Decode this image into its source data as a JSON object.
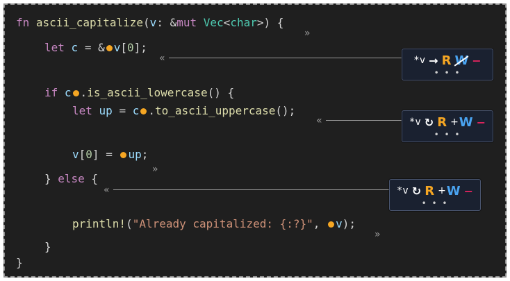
{
  "code": {
    "lines": [
      {
        "id": "l1",
        "tokens": [
          {
            "t": "fn",
            "c": "kw"
          },
          {
            "t": " ",
            "c": "punc"
          },
          {
            "t": "ascii_capitalize",
            "c": "fn"
          },
          {
            "t": "(",
            "c": "punc"
          },
          {
            "t": "v",
            "c": "var"
          },
          {
            "t": ": &",
            "c": "punc"
          },
          {
            "t": "mut",
            "c": "kw"
          },
          {
            "t": " ",
            "c": "punc"
          },
          {
            "t": "Vec",
            "c": "ty"
          },
          {
            "t": "<",
            "c": "punc"
          },
          {
            "t": "char",
            "c": "ty"
          },
          {
            "t": ">) {",
            "c": "punc"
          }
        ]
      },
      {
        "id": "l2",
        "tokens": [
          {
            "t": "let",
            "c": "kw"
          },
          {
            "t": " ",
            "c": "punc"
          },
          {
            "t": "c",
            "c": "var"
          },
          {
            "t": " = &",
            "c": "punc"
          },
          {
            "t": "DOT",
            "c": "dot"
          },
          {
            "t": "v",
            "c": "var"
          },
          {
            "t": "[",
            "c": "punc"
          },
          {
            "t": "0",
            "c": "num"
          },
          {
            "t": "];",
            "c": "punc"
          }
        ]
      },
      {
        "id": "l3",
        "tokens": [
          {
            "t": "if",
            "c": "kw"
          },
          {
            "t": " ",
            "c": "punc"
          },
          {
            "t": "c",
            "c": "var"
          },
          {
            "t": "DOT",
            "c": "dot"
          },
          {
            "t": ".",
            "c": "punc"
          },
          {
            "t": "is_ascii_lowercase",
            "c": "fn"
          },
          {
            "t": "() {",
            "c": "punc"
          }
        ]
      },
      {
        "id": "l4",
        "tokens": [
          {
            "t": "let",
            "c": "kw"
          },
          {
            "t": " ",
            "c": "punc"
          },
          {
            "t": "up",
            "c": "var"
          },
          {
            "t": " = ",
            "c": "punc"
          },
          {
            "t": "c",
            "c": "var"
          },
          {
            "t": "DOT",
            "c": "dot"
          },
          {
            "t": ".",
            "c": "punc"
          },
          {
            "t": "to_ascii_uppercase",
            "c": "fn"
          },
          {
            "t": "();",
            "c": "punc"
          }
        ]
      },
      {
        "id": "l5",
        "tokens": [
          {
            "t": "v",
            "c": "var"
          },
          {
            "t": "[",
            "c": "punc"
          },
          {
            "t": "0",
            "c": "num"
          },
          {
            "t": "] = ",
            "c": "punc"
          },
          {
            "t": "DOT",
            "c": "dot"
          },
          {
            "t": "up",
            "c": "var"
          },
          {
            "t": ";",
            "c": "punc"
          }
        ]
      },
      {
        "id": "l6",
        "tokens": [
          {
            "t": "} ",
            "c": "punc"
          },
          {
            "t": "else",
            "c": "kw"
          },
          {
            "t": " {",
            "c": "punc"
          }
        ]
      },
      {
        "id": "l7",
        "tokens": [
          {
            "t": "println!",
            "c": "fn"
          },
          {
            "t": "(",
            "c": "punc"
          },
          {
            "t": "\"Already capitalized: {:?}\"",
            "c": "str"
          },
          {
            "t": ", ",
            "c": "punc"
          },
          {
            "t": "DOT",
            "c": "dot"
          },
          {
            "t": "v",
            "c": "var"
          },
          {
            "t": ");",
            "c": "punc"
          }
        ]
      },
      {
        "id": "l8",
        "tokens": [
          {
            "t": "}",
            "c": "punc"
          }
        ]
      },
      {
        "id": "l9",
        "tokens": [
          {
            "t": "}",
            "c": "punc"
          }
        ]
      }
    ]
  },
  "markers": {
    "open": "«",
    "close": "»"
  },
  "permission_boxes": [
    {
      "place": "*v",
      "icon": "→",
      "icon_name": "arrow-right-icon",
      "r": "R",
      "w": "W",
      "w_crossed": true,
      "plus": "",
      "minus": "−",
      "more": "• • •"
    },
    {
      "place": "*v",
      "icon": "↻",
      "icon_name": "restore-icon",
      "r": "R",
      "w": "W",
      "w_crossed": false,
      "plus": "+",
      "minus": "−",
      "more": "• • •"
    },
    {
      "place": "*v",
      "icon": "↻",
      "icon_name": "restore-icon",
      "r": "R",
      "w": "W",
      "w_crossed": false,
      "plus": "+",
      "minus": "−",
      "more": "• • •"
    }
  ],
  "colors": {
    "background": "#1f1f1f",
    "read": "#f5a623",
    "write": "#4aa3f0",
    "own": "#e0245e",
    "loan_dot": "#f5a623"
  }
}
